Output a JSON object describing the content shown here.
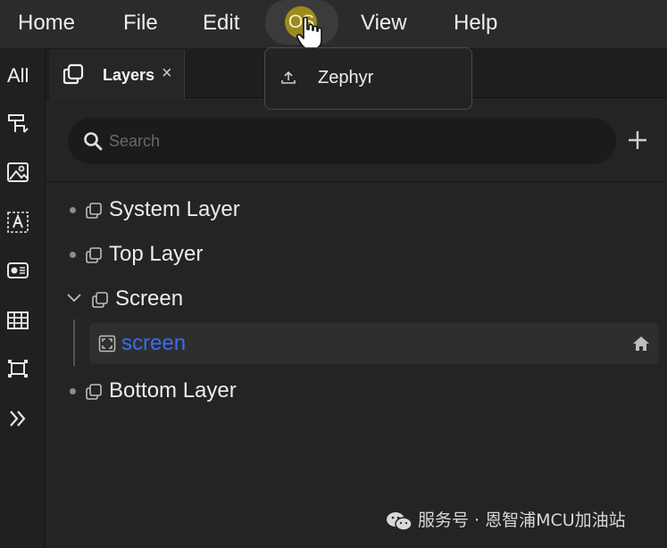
{
  "menubar": {
    "items": [
      {
        "label": "Home"
      },
      {
        "label": "File"
      },
      {
        "label": "Edit"
      },
      {
        "label": "OS"
      },
      {
        "label": "View"
      },
      {
        "label": "Help"
      }
    ]
  },
  "dropdown": {
    "items": [
      {
        "label": "Zephyr",
        "icon": "upload-icon"
      }
    ]
  },
  "rail": {
    "all_label": "All",
    "icons": [
      "widget-icon",
      "image-icon",
      "text-icon",
      "media-icon",
      "table-icon",
      "component-icon",
      "expand-icon"
    ]
  },
  "tab": {
    "label": "Layers",
    "close": "×"
  },
  "search": {
    "placeholder": "Search",
    "value": ""
  },
  "tree": {
    "items": [
      {
        "label": "System Layer"
      },
      {
        "label": "Top Layer"
      },
      {
        "label": "Screen"
      },
      {
        "label": "screen"
      },
      {
        "label": "Bottom Layer"
      }
    ]
  },
  "colors": {
    "accent_os": "#9c8a1c",
    "selected_text": "#3b6cf0",
    "background": "#242424"
  },
  "watermark": {
    "text": "服务号 · 恩智浦MCU加油站"
  }
}
